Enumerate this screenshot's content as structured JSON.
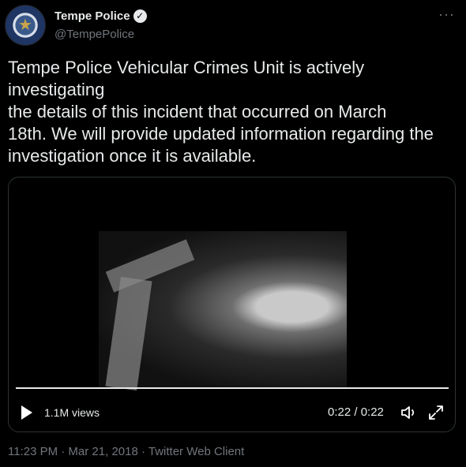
{
  "author": {
    "name": "Tempe Police",
    "handle": "@TempePolice",
    "verified_symbol": "✓",
    "more_symbol": "···"
  },
  "tweet": {
    "lines": [
      "Tempe Police Vehicular Crimes Unit is actively",
      "investigating",
      "the details of this incident that occurred on March",
      "18th. We will provide updated information regarding the",
      "investigation once it is available."
    ]
  },
  "video": {
    "views": "1.1M views",
    "time": "0:22 / 0:22",
    "progress": 1.0
  },
  "meta": {
    "text": "11:23 PM · Mar 21, 2018 · Twitter Web Client"
  },
  "icons": [
    "avatar",
    "verified-badge-icon",
    "more-icon",
    "play-icon",
    "volume-icon",
    "fullscreen-icon"
  ]
}
